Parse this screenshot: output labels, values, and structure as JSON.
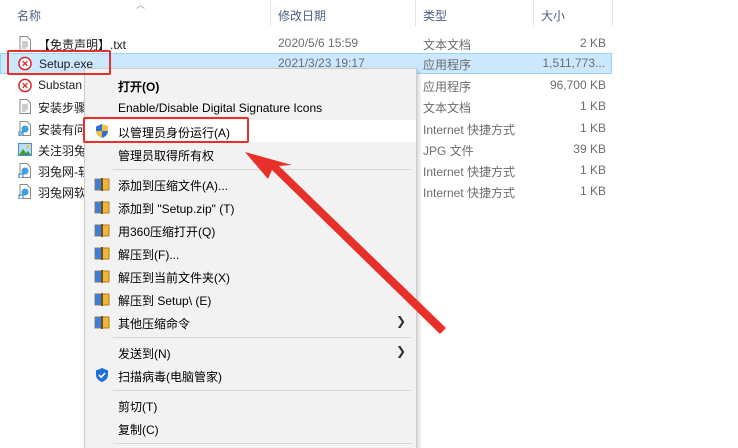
{
  "columns": {
    "name": "名称",
    "date": "修改日期",
    "type": "类型",
    "size": "大小"
  },
  "files": [
    {
      "name": "【免责声明】.txt",
      "date": "2020/5/6 15:59",
      "type": "文本文档",
      "size": "2 KB",
      "icon": "text-file-icon"
    },
    {
      "name": "Setup.exe",
      "date": "2021/3/23 19:17",
      "type": "应用程序",
      "size": "1,511,773...",
      "icon": "setup-exe-icon"
    },
    {
      "name": "Substan",
      "date": "",
      "type": "应用程序",
      "size": "96,700 KB",
      "icon": "app-exe-icon"
    },
    {
      "name": "安装步骤",
      "date": "",
      "type": "文本文档",
      "size": "1 KB",
      "icon": "text-file-icon"
    },
    {
      "name": "安装有问",
      "date": "",
      "type": "Internet 快捷方式",
      "size": "1 KB",
      "icon": "internet-shortcut-icon"
    },
    {
      "name": "关注羽兔",
      "date": "",
      "type": "JPG 文件",
      "size": "39 KB",
      "icon": "image-file-icon"
    },
    {
      "name": "羽兔网-软",
      "date": "",
      "type": "Internet 快捷方式",
      "size": "1 KB",
      "icon": "internet-shortcut-icon"
    },
    {
      "name": "羽兔网软",
      "date": "",
      "type": "Internet 快捷方式",
      "size": "1 KB",
      "icon": "internet-shortcut-icon"
    }
  ],
  "menu": {
    "open": "打开(O)",
    "signature": "Enable/Disable Digital Signature Icons",
    "run_as_admin": "以管理员身份运行(A)",
    "take_ownership": "管理员取得所有权",
    "add_to_archive": "添加到压缩文件(A)...",
    "add_to_zip": "添加到 \"Setup.zip\" (T)",
    "open_with_360": "用360压缩打开(Q)",
    "extract_to": "解压到(F)...",
    "extract_here": "解压到当前文件夹(X)",
    "extract_to_folder": "解压到 Setup\\ (E)",
    "other_compress": "其他压缩命令",
    "send_to": "发送到(N)",
    "scan_virus": "扫描病毒(电脑管家)",
    "cut": "剪切(T)",
    "copy": "复制(C)"
  },
  "colors": {
    "selection": "#cce8ff",
    "highlight_red": "#e8302a",
    "menu_bg": "#f2f2f2"
  }
}
